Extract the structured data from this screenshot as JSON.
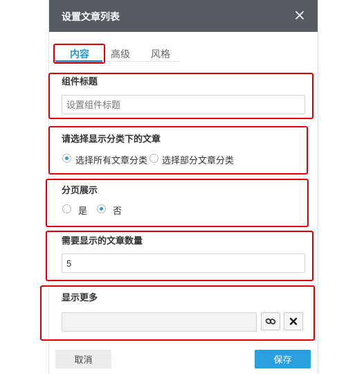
{
  "dialog": {
    "title": "设置文章列表"
  },
  "tabs": [
    {
      "label": "内容",
      "active": true
    },
    {
      "label": "高级",
      "active": false
    },
    {
      "label": "风格",
      "active": false
    }
  ],
  "component_title": {
    "label": "组件标题",
    "value": "",
    "placeholder": "设置组件标题"
  },
  "category": {
    "label": "请选择显示分类下的文章",
    "options": [
      {
        "label": "选择所有文章分类",
        "selected": true
      },
      {
        "label": "选择部分文章分类",
        "selected": false
      }
    ]
  },
  "pagination": {
    "label": "分页展示",
    "options": [
      {
        "label": "是",
        "selected": false
      },
      {
        "label": "否",
        "selected": true
      }
    ]
  },
  "article_count": {
    "label": "需要显示的文章数量",
    "value": "5"
  },
  "show_more": {
    "label": "显示更多",
    "value": "",
    "link_icon": "link-icon",
    "clear_icon": "x-icon"
  },
  "footer": {
    "cancel_label": "取消",
    "save_label": "保存"
  },
  "colors": {
    "accent": "#2a95d5",
    "header_bg": "#555b61",
    "highlight": "#e00000"
  }
}
